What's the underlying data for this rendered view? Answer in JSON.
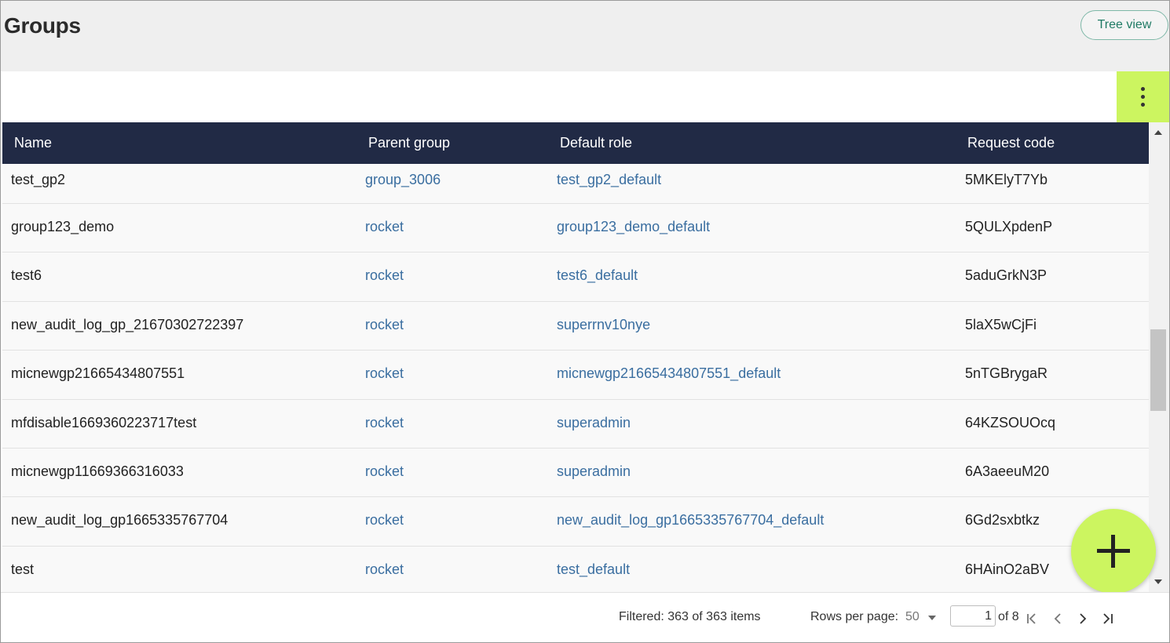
{
  "header": {
    "title": "Groups",
    "tree_view_label": "Tree view"
  },
  "table": {
    "columns": [
      "Name",
      "Parent group",
      "Default role",
      "Request code"
    ],
    "rows": [
      {
        "name": "test_gp2",
        "parent": "group_3006",
        "role": "test_gp2_default",
        "code": "5MKElyT7Yb"
      },
      {
        "name": "group123_demo",
        "parent": "rocket",
        "role": "group123_demo_default",
        "code": "5QULXpdenP"
      },
      {
        "name": "test6",
        "parent": "rocket",
        "role": "test6_default",
        "code": "5aduGrkN3P"
      },
      {
        "name": "new_audit_log_gp_21670302722397",
        "parent": "rocket",
        "role": "superrnv10nye",
        "code": "5laX5wCjFi"
      },
      {
        "name": "micnewgp21665434807551",
        "parent": "rocket",
        "role": "micnewgp21665434807551_default",
        "code": "5nTGBrygaR"
      },
      {
        "name": "mfdisable1669360223717test",
        "parent": "rocket",
        "role": "superadmin",
        "code": "64KZSOUOcq"
      },
      {
        "name": "micnewgp11669366316033",
        "parent": "rocket",
        "role": "superadmin",
        "code": "6A3aeeuM20"
      },
      {
        "name": "new_audit_log_gp1665335767704",
        "parent": "rocket",
        "role": "new_audit_log_gp1665335767704_default",
        "code": "6Gd2sxbtkz"
      },
      {
        "name": "test",
        "parent": "rocket",
        "role": "test_default",
        "code": "6HAinO2aBV"
      }
    ]
  },
  "footer": {
    "filtered_text": "Filtered: 363 of 363 items",
    "rows_per_page_label": "Rows per page:",
    "rows_per_page_value": "50",
    "current_page": "1",
    "page_of": "of 8"
  },
  "icons": {
    "more": "more-vertical-icon",
    "add": "plus-icon",
    "first": "first-page-icon",
    "prev": "chevron-left-icon",
    "next": "chevron-right-icon",
    "last": "last-page-icon"
  },
  "colors": {
    "accent": "#ccf560",
    "table_header": "#212a45",
    "link": "#3a6ea0",
    "tree_button": "#1f7a64"
  }
}
